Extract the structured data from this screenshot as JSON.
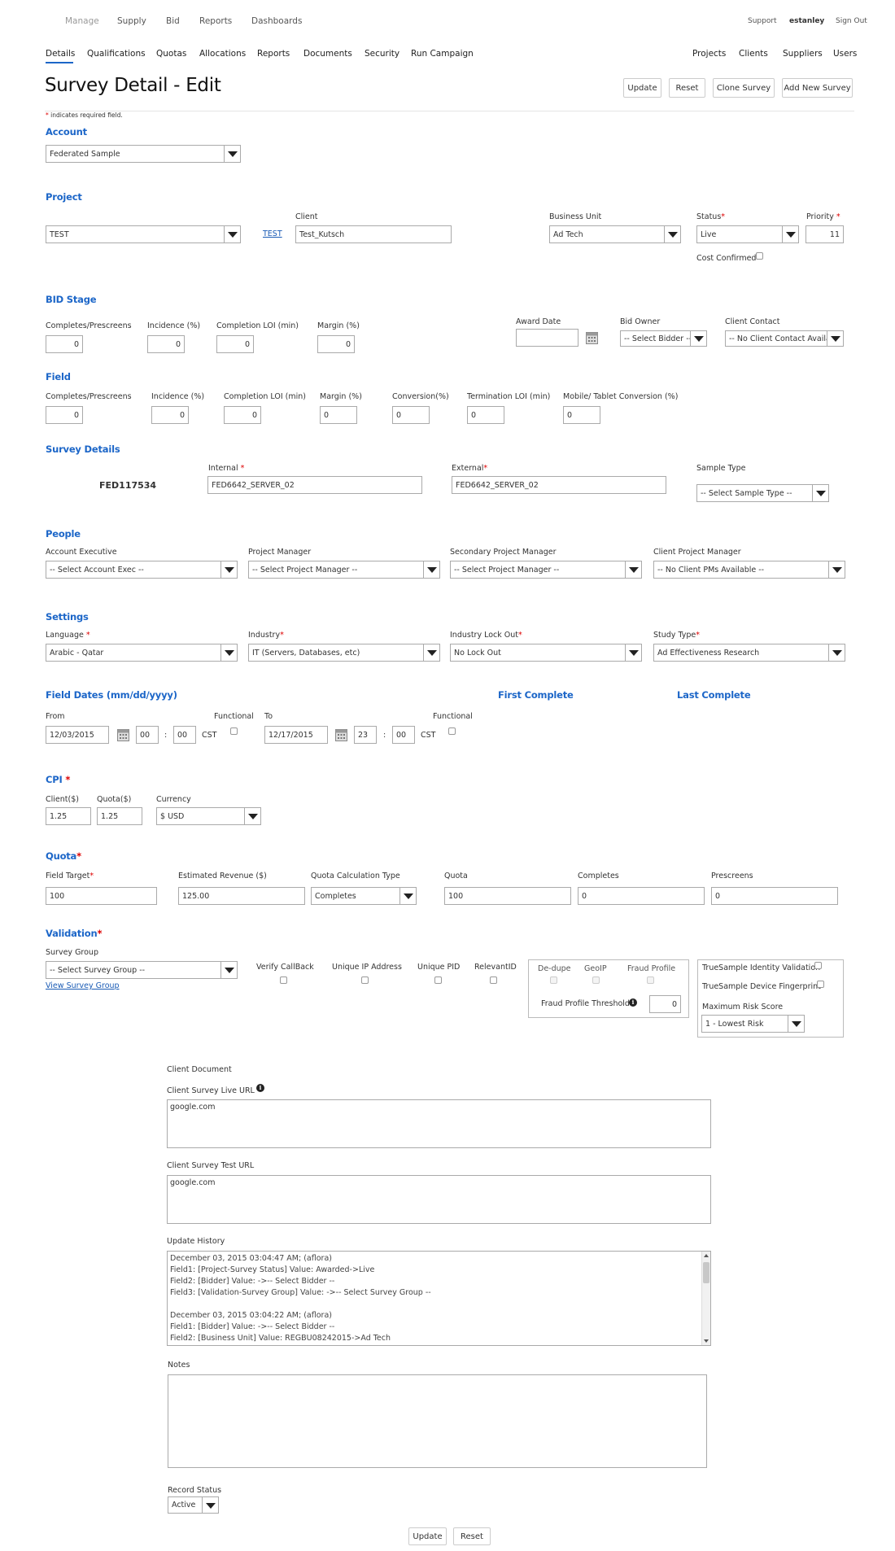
{
  "top_nav": {
    "items": [
      "Manage",
      "Supply",
      "Bid",
      "Reports",
      "Dashboards"
    ],
    "right": {
      "support": "Support",
      "user": "estanley",
      "signout": "Sign Out"
    }
  },
  "sub_nav": {
    "items": [
      "Details",
      "Qualifications",
      "Quotas",
      "Allocations",
      "Reports",
      "Documents",
      "Security",
      "Run Campaign"
    ],
    "right": [
      "Projects",
      "Clients",
      "Suppliers",
      "Users"
    ]
  },
  "page": {
    "title": "Survey Detail - Edit",
    "required_note": "indicates required field.",
    "asterisk": "*"
  },
  "actions": {
    "update": "Update",
    "reset": "Reset",
    "clone": "Clone Survey",
    "add_new": "Add New Survey"
  },
  "account": {
    "heading": "Account",
    "value": "Federated Sample"
  },
  "project": {
    "heading": "Project",
    "value": "TEST",
    "link": "TEST",
    "client_label": "Client",
    "client_value": "Test_Kutsch",
    "bu_label": "Business Unit",
    "bu_value": "Ad Tech",
    "status_label": "Status",
    "status_value": "Live",
    "priority_label": "Priority",
    "priority_value": "11",
    "cost_confirmed": "Cost Confirmed"
  },
  "bid": {
    "heading": "BID Stage",
    "completes_label": "Completes/Prescreens",
    "completes": "0",
    "incidence_label": "Incidence (%)",
    "incidence": "0",
    "loi_label": "Completion LOI (min)",
    "loi": "0",
    "margin_label": "Margin (%)",
    "margin": "0",
    "award_label": "Award Date",
    "award": "",
    "owner_label": "Bid Owner",
    "owner": "-- Select Bidder --",
    "contact_label": "Client Contact",
    "contact": "-- No Client Contact Available --"
  },
  "field": {
    "heading": "Field",
    "completes_label": "Completes/Prescreens",
    "completes": "0",
    "incidence_label": "Incidence (%)",
    "incidence": "0",
    "loi_label": "Completion LOI (min)",
    "loi": "0",
    "margin_label": "Margin (%)",
    "margin": "0",
    "conversion_label": "Conversion(%)",
    "conversion": "0",
    "term_label": "Termination LOI (min)",
    "term": "0",
    "mobile_label": "Mobile/ Tablet Conversion (%)",
    "mobile": "0"
  },
  "survey": {
    "heading": "Survey Details",
    "id": "FED117534",
    "internal_label": "Internal",
    "internal": "FED6642_SERVER_02",
    "external_label": "External",
    "external": "FED6642_SERVER_02",
    "sample_label": "Sample Type",
    "sample": "-- Select Sample Type --"
  },
  "people": {
    "heading": "People",
    "ae_label": "Account Executive",
    "ae": "-- Select Account Exec --",
    "pm_label": "Project Manager",
    "pm": "-- Select Project Manager --",
    "spm_label": "Secondary Project Manager",
    "spm": "-- Select Project Manager --",
    "cpm_label": "Client Project Manager",
    "cpm": "-- No Client PMs Available --"
  },
  "settings": {
    "heading": "Settings",
    "lang_label": "Language",
    "lang": "Arabic - Qatar",
    "industry_label": "Industry",
    "industry": "IT (Servers, Databases, etc)",
    "lockout_label": "Industry Lock Out",
    "lockout": "No Lock Out",
    "study_label": "Study Type",
    "study": "Ad Effectiveness Research"
  },
  "dates": {
    "heading": "Field Dates (mm/dd/yyyy)",
    "first_complete": "First Complete",
    "last_complete": "Last Complete",
    "from_label": "From",
    "from_date": "12/03/2015",
    "from_hh": "00",
    "from_mm": "00",
    "tz": "CST",
    "functional": "Functional",
    "to_label": "To",
    "to_date": "12/17/2015",
    "to_hh": "23",
    "to_mm": "00",
    "colon": ":"
  },
  "cpi": {
    "heading": "CPI",
    "client_label": "Client($)",
    "client": "1.25",
    "quota_label": "Quota($)",
    "quota": "1.25",
    "currency_label": "Currency",
    "currency": "$ USD"
  },
  "quota": {
    "heading": "Quota",
    "target_label": "Field Target",
    "target": "100",
    "revenue_label": "Estimated Revenue ($)",
    "revenue": "125.00",
    "calc_label": "Quota Calculation Type",
    "calc": "Completes",
    "quota_label": "Quota",
    "quota": "100",
    "completes_label": "Completes",
    "completes": "0",
    "prescreens_label": "Prescreens",
    "prescreens": "0"
  },
  "validation": {
    "heading": "Validation",
    "group_label": "Survey Group",
    "group": "-- Select Survey Group --",
    "view_group": "View Survey Group",
    "verify": "Verify CallBack",
    "unique_ip": "Unique IP Address",
    "unique_pid": "Unique PID",
    "relevant": "RelevantID",
    "dedupe": "De-dupe",
    "geoip": "GeoIP",
    "fraud": "Fraud Profile",
    "threshold_label": "Fraud Profile Threshold",
    "threshold": "0",
    "ts_identity": "TrueSample Identity Validation",
    "ts_device": "TrueSample Device Fingerprint",
    "risk_label": "Maximum Risk Score",
    "risk": "1 - Lowest Risk"
  },
  "client_doc": {
    "label": "Client Document",
    "live_label": "Client Survey Live URL",
    "live": "google.com",
    "test_label": "Client Survey Test URL",
    "test": "google.com"
  },
  "history": {
    "label": "Update History",
    "lines": [
      "December 03, 2015 03:04:47 AM;   (aflora)",
      "Field1: [Project-Survey Status] Value: Awarded->Live",
      "Field2: [Bidder] Value: ->-- Select Bidder --",
      "Field3: [Validation-Survey Group] Value: ->-- Select Survey Group --",
      "",
      "December 03, 2015 03:04:22 AM;   (aflora)",
      "Field1: [Bidder] Value: ->-- Select Bidder --",
      "Field2: [Business Unit] Value: REGBU08242015->Ad Tech"
    ]
  },
  "notes": {
    "label": "Notes",
    "value": ""
  },
  "record": {
    "label": "Record Status",
    "value": "Active"
  },
  "footer": {
    "update": "Update",
    "reset": "Reset"
  },
  "colors": {
    "accent": "#1c66c8",
    "required": "#dd0000",
    "link": "#1a5bb5"
  }
}
